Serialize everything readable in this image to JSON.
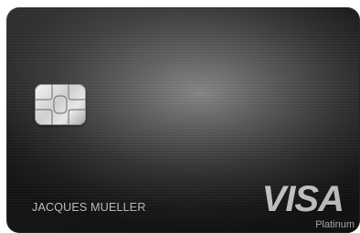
{
  "card": {
    "cardholder_name": "JACQUES MUELLER",
    "network_logo": "VISA",
    "tier": "Platinum",
    "chip_icon": "emv-chip-icon"
  },
  "colors": {
    "card_base": "#1c1c1c",
    "card_highlight": "#8a8a8a",
    "text": "#d6d6d6",
    "logo": "#e9e9e9"
  }
}
